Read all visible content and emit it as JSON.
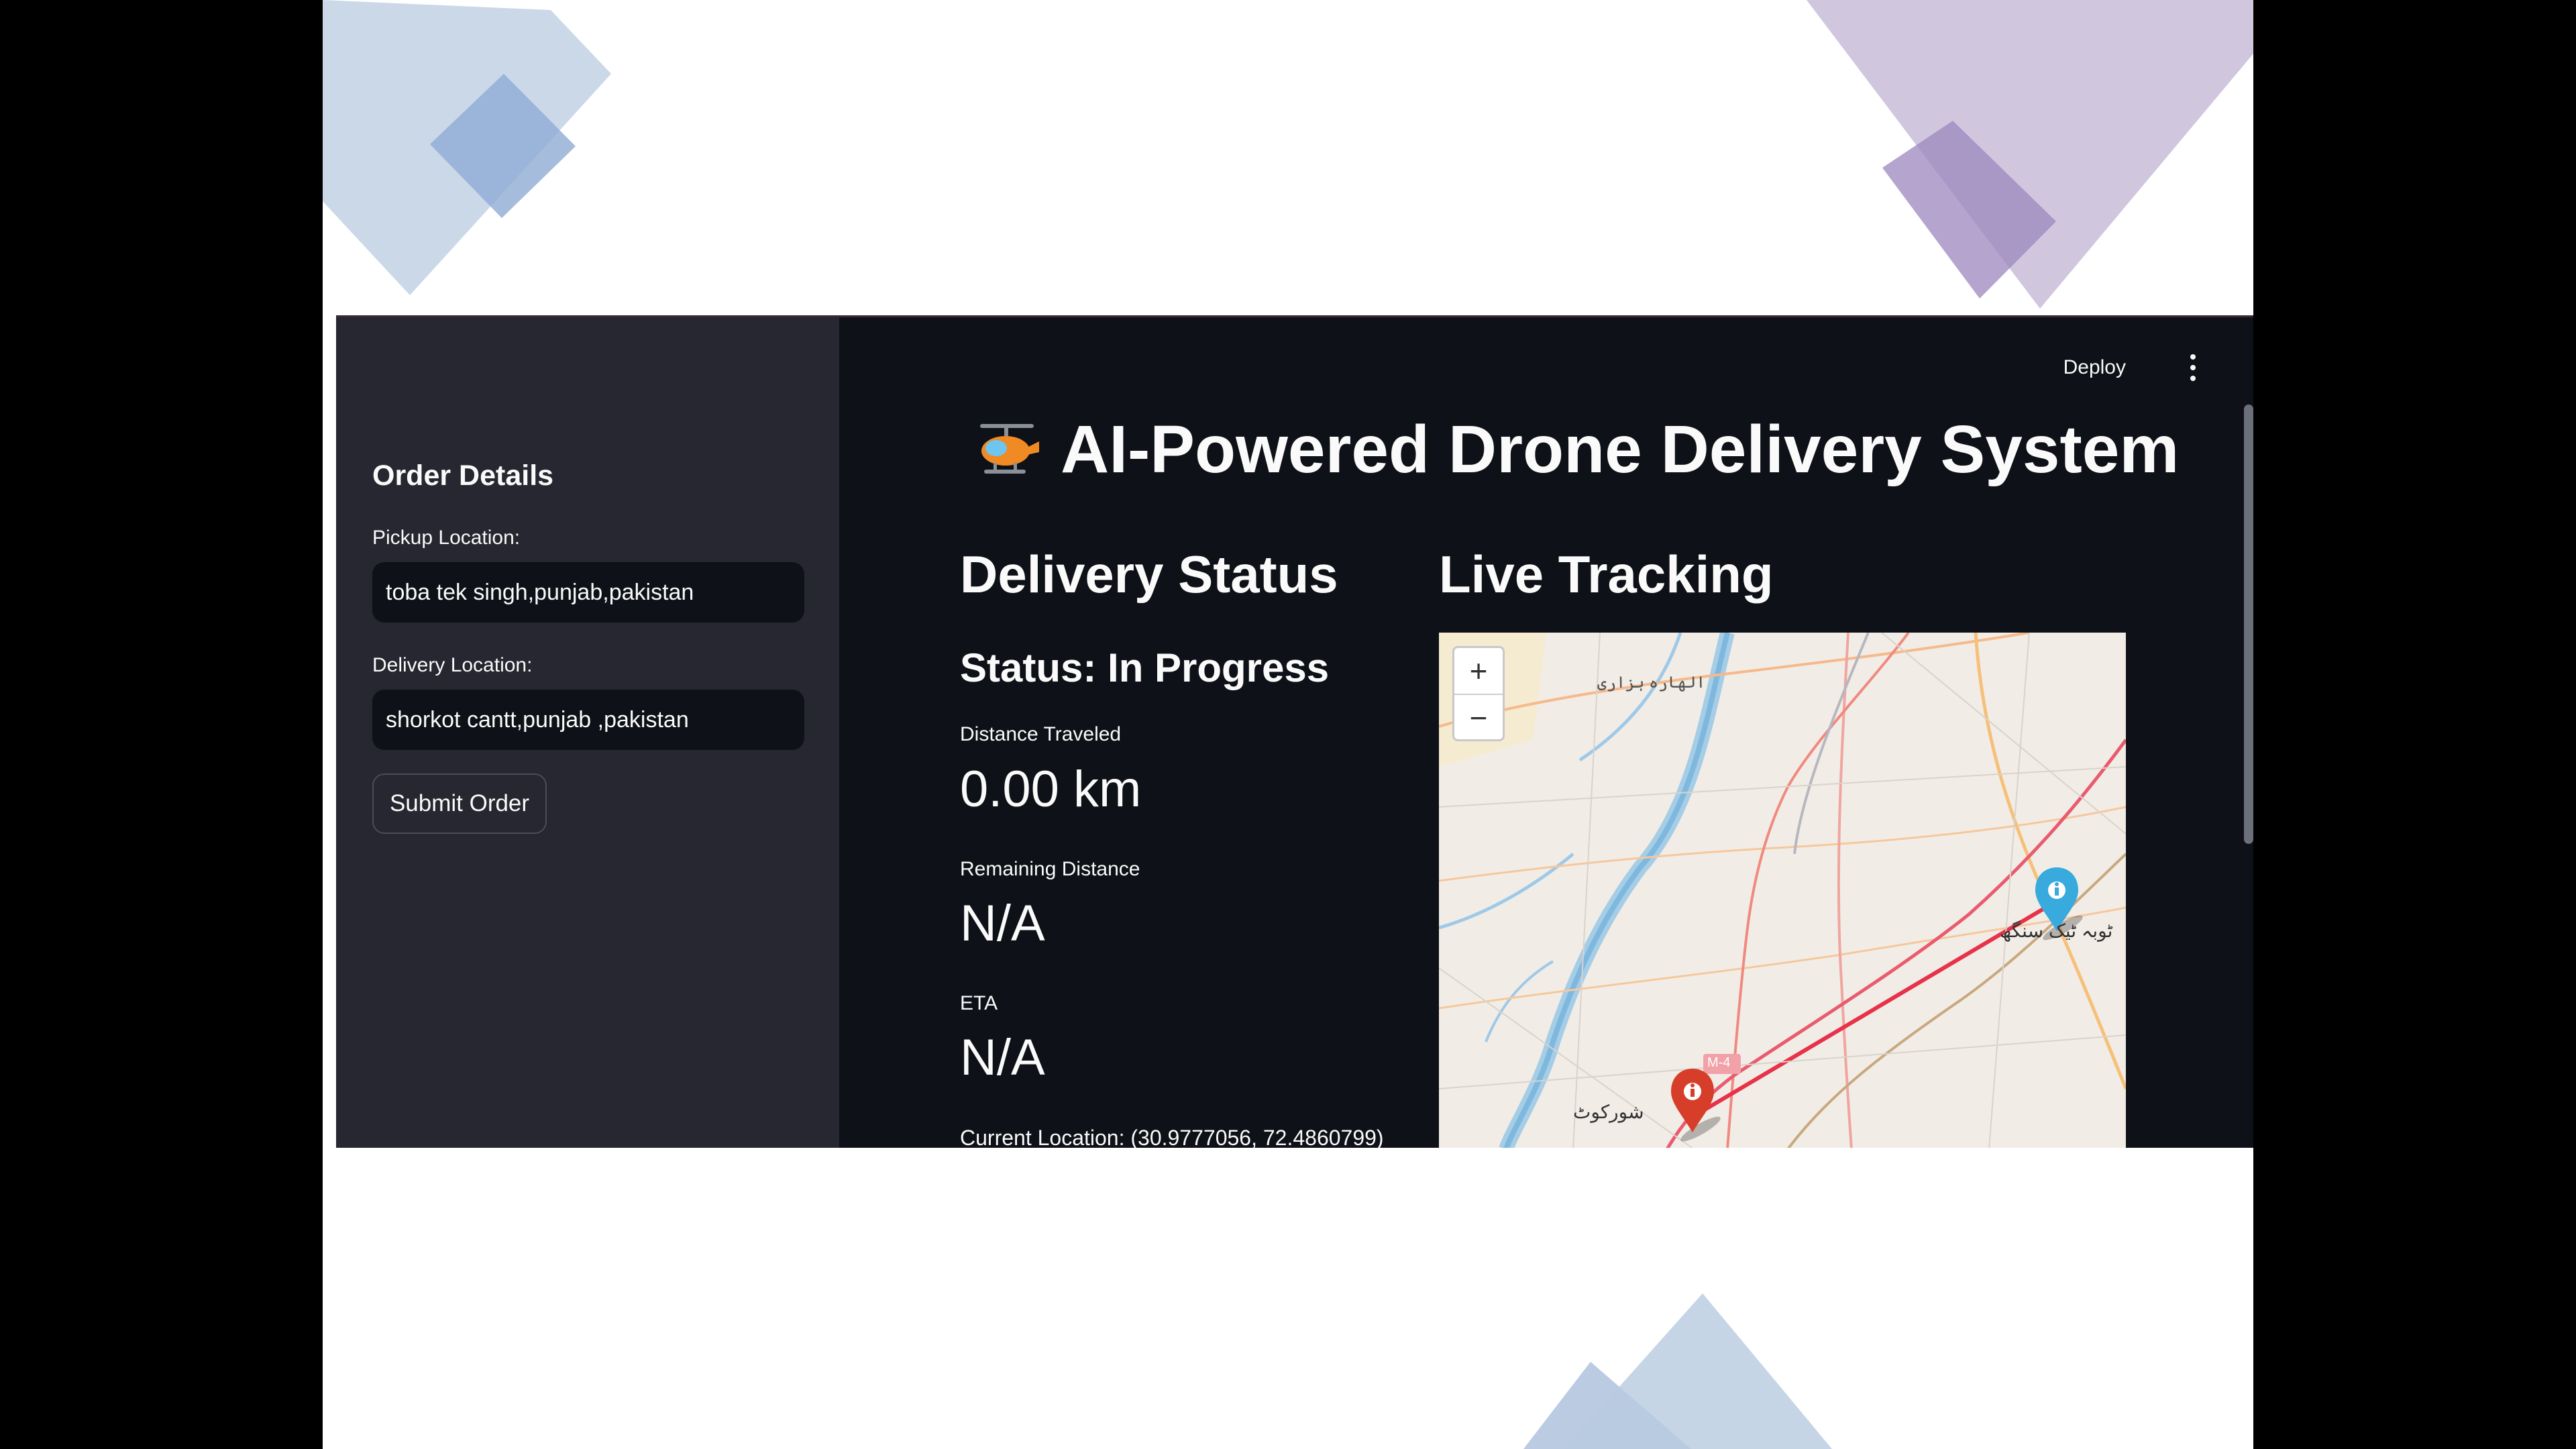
{
  "sidebar": {
    "title": "Order Details",
    "pickup_label": "Pickup Location:",
    "pickup_value": "toba tek singh,punjab,pakistan",
    "delivery_label": "Delivery Location:",
    "delivery_value": "shorkot cantt,punjab ,pakistan",
    "submit_label": "Submit Order"
  },
  "header": {
    "deploy_label": "Deploy",
    "title": "AI-Powered Drone Delivery System"
  },
  "status": {
    "heading": "Delivery Status",
    "status_line": "Status: In Progress",
    "distance_label": "Distance Traveled",
    "distance_value": "0.00 km",
    "remaining_label": "Remaining Distance",
    "remaining_value": "N/A",
    "eta_label": "ETA",
    "eta_value": "N/A",
    "current_location": "Current Location: (30.9777056, 72.4860799)"
  },
  "tracking": {
    "heading": "Live Tracking",
    "zoom_in": "+",
    "zoom_out": "−",
    "place_top": "الھارہ ہزاری",
    "place_pickup": "ٹوبہ ٹیک سنگھ",
    "place_delivery": "شورکوٹ",
    "road_shield": "M-4"
  },
  "colors": {
    "app_bg": "#0e1117",
    "sidebar_bg": "#262730",
    "text": "#fafafa",
    "pickup_marker": "#38aadd",
    "delivery_marker": "#d63e2a",
    "route": "#e8324a"
  }
}
